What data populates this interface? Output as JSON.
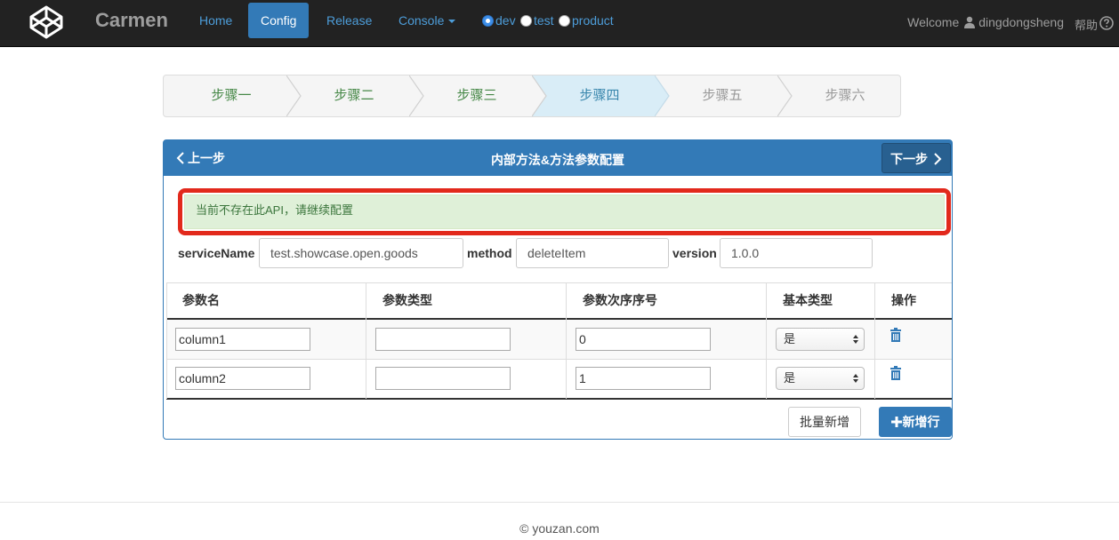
{
  "navbar": {
    "brand": "Carmen",
    "links": [
      {
        "label": "Home",
        "active": false
      },
      {
        "label": "Config",
        "active": true
      },
      {
        "label": "Release",
        "active": false
      },
      {
        "label": "Console",
        "active": false,
        "dropdown": true
      }
    ],
    "environments": [
      {
        "label": "dev",
        "checked": true
      },
      {
        "label": "test",
        "checked": false
      },
      {
        "label": "product",
        "checked": false
      }
    ],
    "welcome_text": "Welcome",
    "username": "dingdongsheng",
    "help_label": "帮助",
    "icons": {
      "logo": "codepen-logo-icon",
      "user": "user-icon",
      "help": "question-circle-icon"
    }
  },
  "steps": [
    {
      "label": "步骤一",
      "state": "done"
    },
    {
      "label": "步骤二",
      "state": "done"
    },
    {
      "label": "步骤三",
      "state": "done"
    },
    {
      "label": "步骤四",
      "state": "current"
    },
    {
      "label": "步骤五",
      "state": "future"
    },
    {
      "label": "步骤六",
      "state": "future"
    }
  ],
  "panel": {
    "prev_label": "上一步",
    "title": "内部方法&方法参数配置",
    "next_label": "下一步",
    "alert": "当前不存在此API，请继续配置",
    "fields": {
      "service_name": {
        "label": "serviceName",
        "value": "test.showcase.open.goods"
      },
      "method": {
        "label": "method",
        "value": "deleteItem"
      },
      "version": {
        "label": "version",
        "value": "1.0.0"
      }
    },
    "table": {
      "headers": [
        "参数名",
        "参数类型",
        "参数次序序号",
        "基本类型",
        "操作"
      ],
      "rows": [
        {
          "name": "column1",
          "type": "",
          "order": "0",
          "basic": "是"
        },
        {
          "name": "column2",
          "type": "",
          "order": "1",
          "basic": "是"
        }
      ]
    },
    "batch_add_label": "批量新增",
    "add_label": "新增行"
  },
  "footer": "© youzan.com",
  "colors": {
    "navbar_bg": "#222222",
    "primary": "#337ab7",
    "alert_bg": "#dff0d8",
    "highlight_border": "#e2291c"
  }
}
